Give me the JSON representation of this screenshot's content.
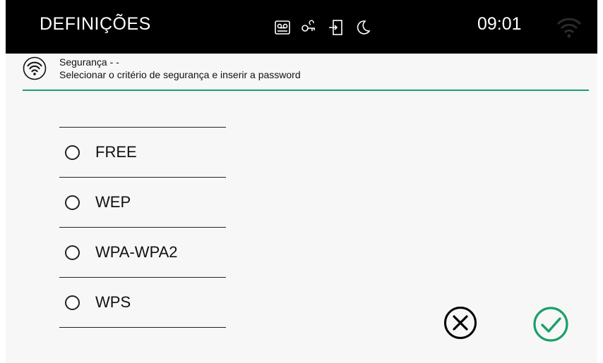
{
  "topbar": {
    "title": "DEFINIÇÕES",
    "time": "09:01",
    "status_icons": [
      "voicemail-icon",
      "key-icon",
      "door-entry-icon",
      "moon-icon"
    ],
    "wifi_icon": "wifi-icon"
  },
  "header": {
    "icon": "wifi-signal-icon",
    "title": "Segurança - -",
    "subtitle": "Selecionar o critério de segurança e inserir a password",
    "accent_color": "#1aa068"
  },
  "security_options": [
    {
      "label": "FREE",
      "selected": false
    },
    {
      "label": "WEP",
      "selected": false
    },
    {
      "label": "WPA-WPA2",
      "selected": false
    },
    {
      "label": "WPS",
      "selected": false
    }
  ],
  "actions": {
    "cancel_icon": "cancel-icon",
    "confirm_icon": "confirm-icon",
    "confirm_color": "#1aa068"
  }
}
